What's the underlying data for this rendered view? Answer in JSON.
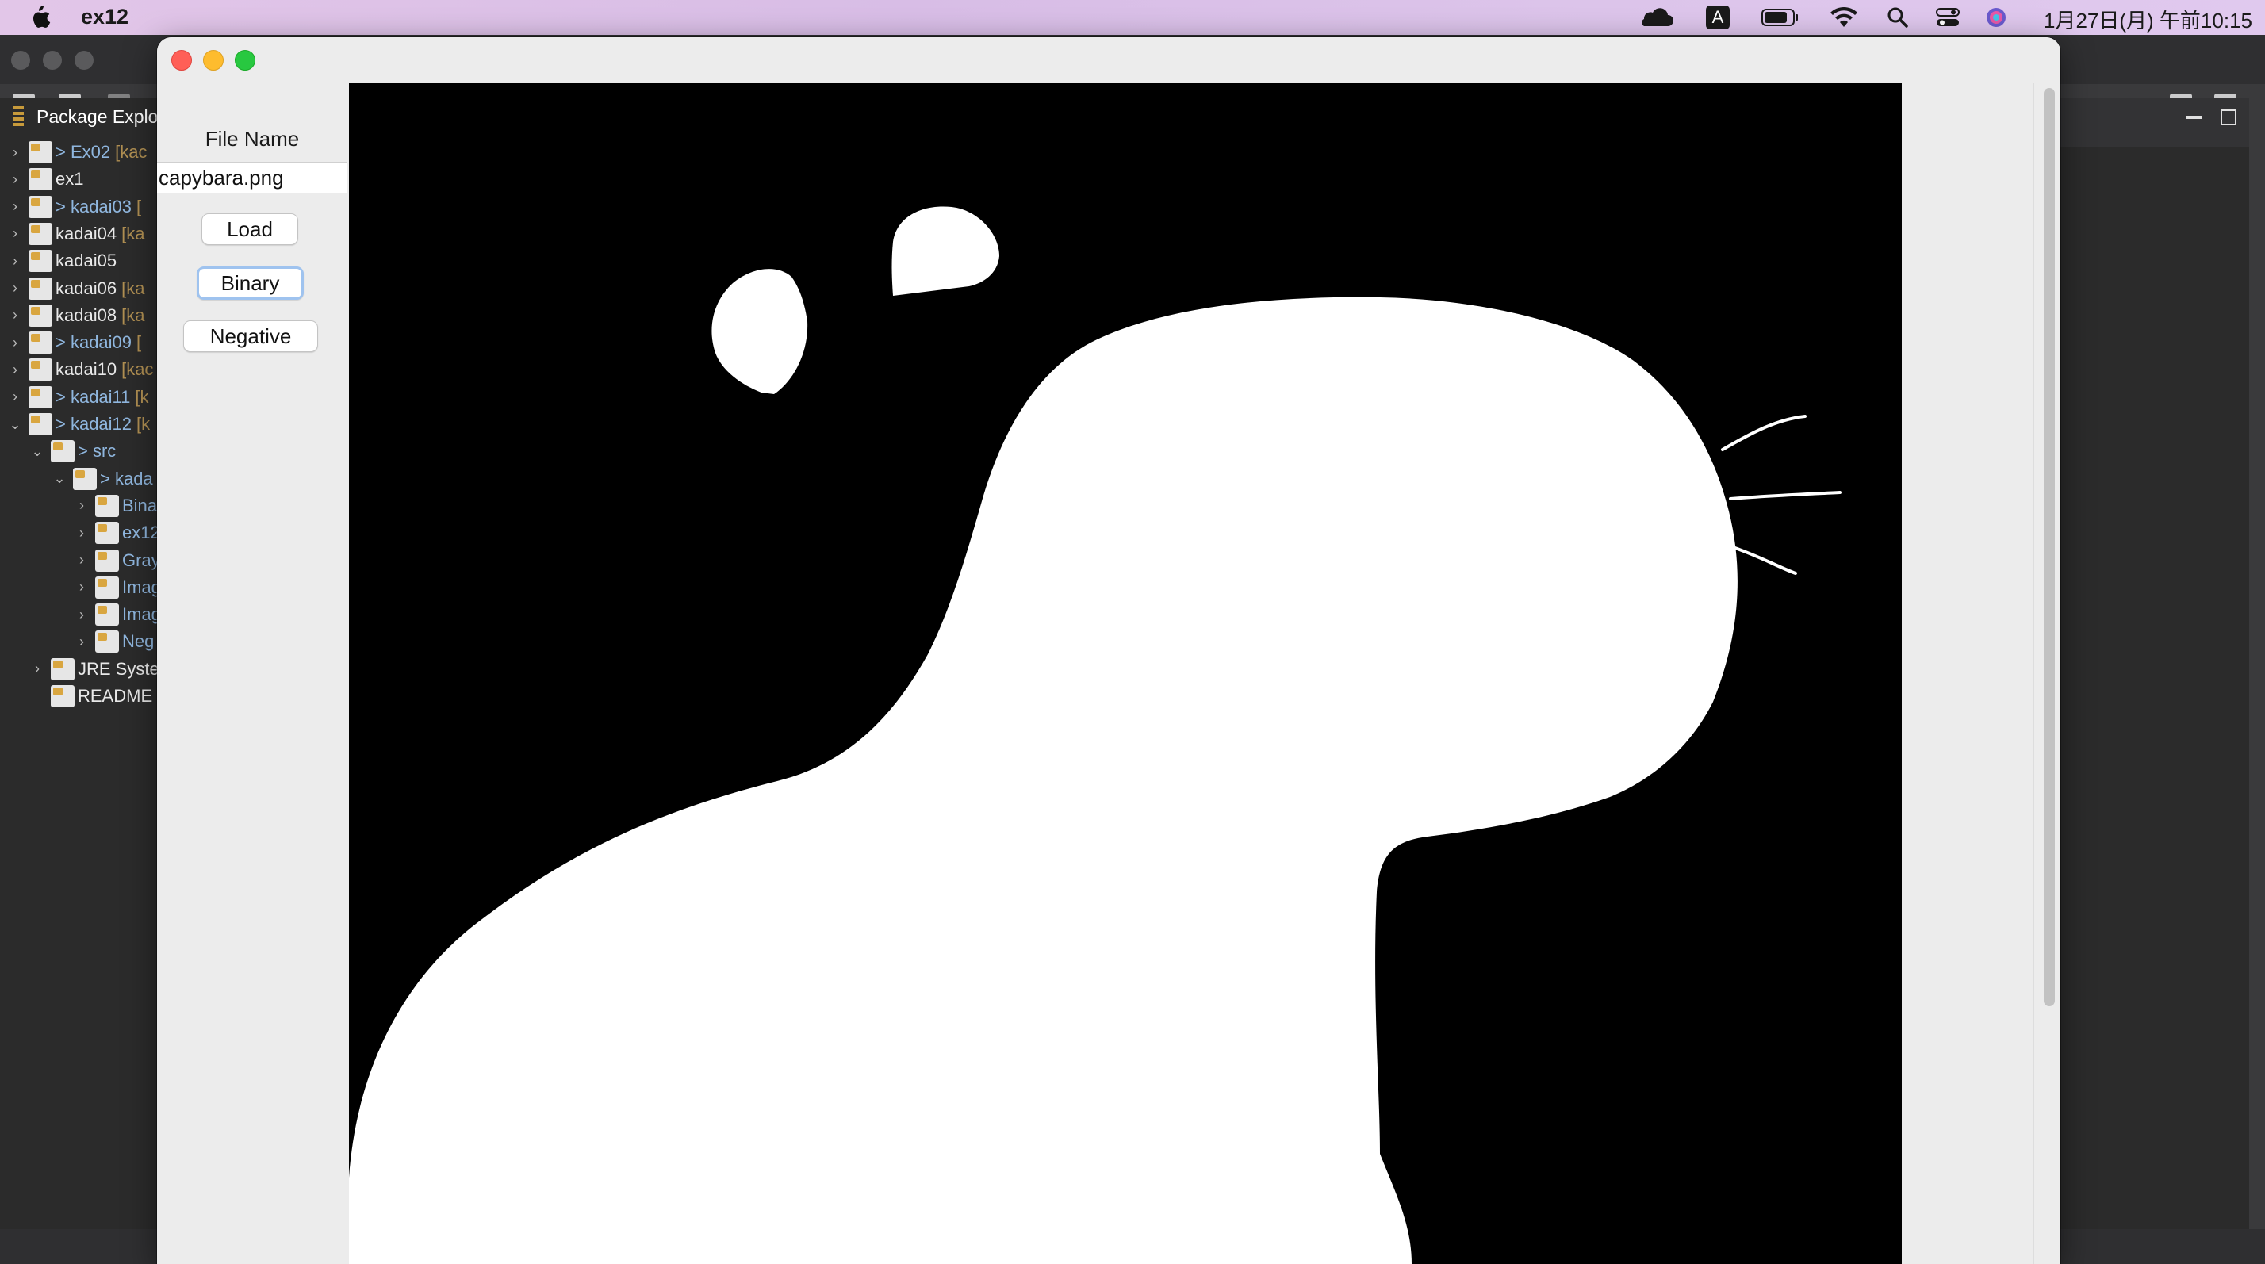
{
  "menubar": {
    "app_name": "ex12",
    "clock": "1月27日(月) 午前10:15",
    "icons": [
      "apple-icon",
      "cloud-icon",
      "input-method-icon",
      "battery-icon",
      "wifi-icon",
      "spotlight-search-icon",
      "control-center-icon",
      "siri-icon"
    ],
    "input_method": "A"
  },
  "eclipse": {
    "package_explorer_title": "Package Explo",
    "tree": [
      {
        "label": "> Ex02",
        "deco": "[kac",
        "link": true,
        "depth": 0,
        "expanded": false
      },
      {
        "label": "ex1",
        "deco": "",
        "link": false,
        "depth": 0,
        "expanded": false
      },
      {
        "label": "> kadai03",
        "deco": "[",
        "link": true,
        "depth": 0,
        "expanded": false
      },
      {
        "label": "kadai04",
        "deco": "[ka",
        "link": false,
        "depth": 0,
        "expanded": false
      },
      {
        "label": "kadai05",
        "deco": "",
        "link": false,
        "depth": 0,
        "expanded": false
      },
      {
        "label": "kadai06",
        "deco": "[ka",
        "link": false,
        "depth": 0,
        "expanded": false
      },
      {
        "label": "kadai08",
        "deco": "[ka",
        "link": false,
        "depth": 0,
        "expanded": false
      },
      {
        "label": "> kadai09",
        "deco": "[",
        "link": true,
        "depth": 0,
        "expanded": false
      },
      {
        "label": "kadai10",
        "deco": "[kac",
        "link": false,
        "depth": 0,
        "expanded": false
      },
      {
        "label": "> kadai11",
        "deco": "[k",
        "link": true,
        "depth": 0,
        "expanded": false
      },
      {
        "label": "> kadai12",
        "deco": "[k",
        "link": true,
        "depth": 0,
        "expanded": true
      },
      {
        "label": "> src",
        "deco": "",
        "link": true,
        "depth": 1,
        "expanded": true
      },
      {
        "label": "> kada",
        "deco": "",
        "link": true,
        "depth": 2,
        "expanded": true
      },
      {
        "label": "Bina",
        "deco": "",
        "link": true,
        "depth": 3,
        "expanded": false
      },
      {
        "label": "ex12",
        "deco": "",
        "link": true,
        "depth": 3,
        "expanded": false
      },
      {
        "label": "Gray",
        "deco": "",
        "link": true,
        "depth": 3,
        "expanded": false
      },
      {
        "label": "Imag",
        "deco": "",
        "link": true,
        "depth": 3,
        "expanded": false
      },
      {
        "label": "Imag",
        "deco": "",
        "link": true,
        "depth": 3,
        "expanded": false
      },
      {
        "label": "Neg",
        "deco": "",
        "link": true,
        "depth": 3,
        "expanded": false
      },
      {
        "label": "JRE Syste",
        "deco": "",
        "link": false,
        "depth": 1,
        "expanded": false
      },
      {
        "label": "README",
        "deco": "",
        "link": false,
        "depth": 1,
        "leaf": true
      }
    ]
  },
  "app": {
    "file_name_label": "File Name",
    "file_name_value": "capybara.png",
    "load_label": "Load",
    "binary_label": "Binary",
    "negative_label": "Negative"
  }
}
